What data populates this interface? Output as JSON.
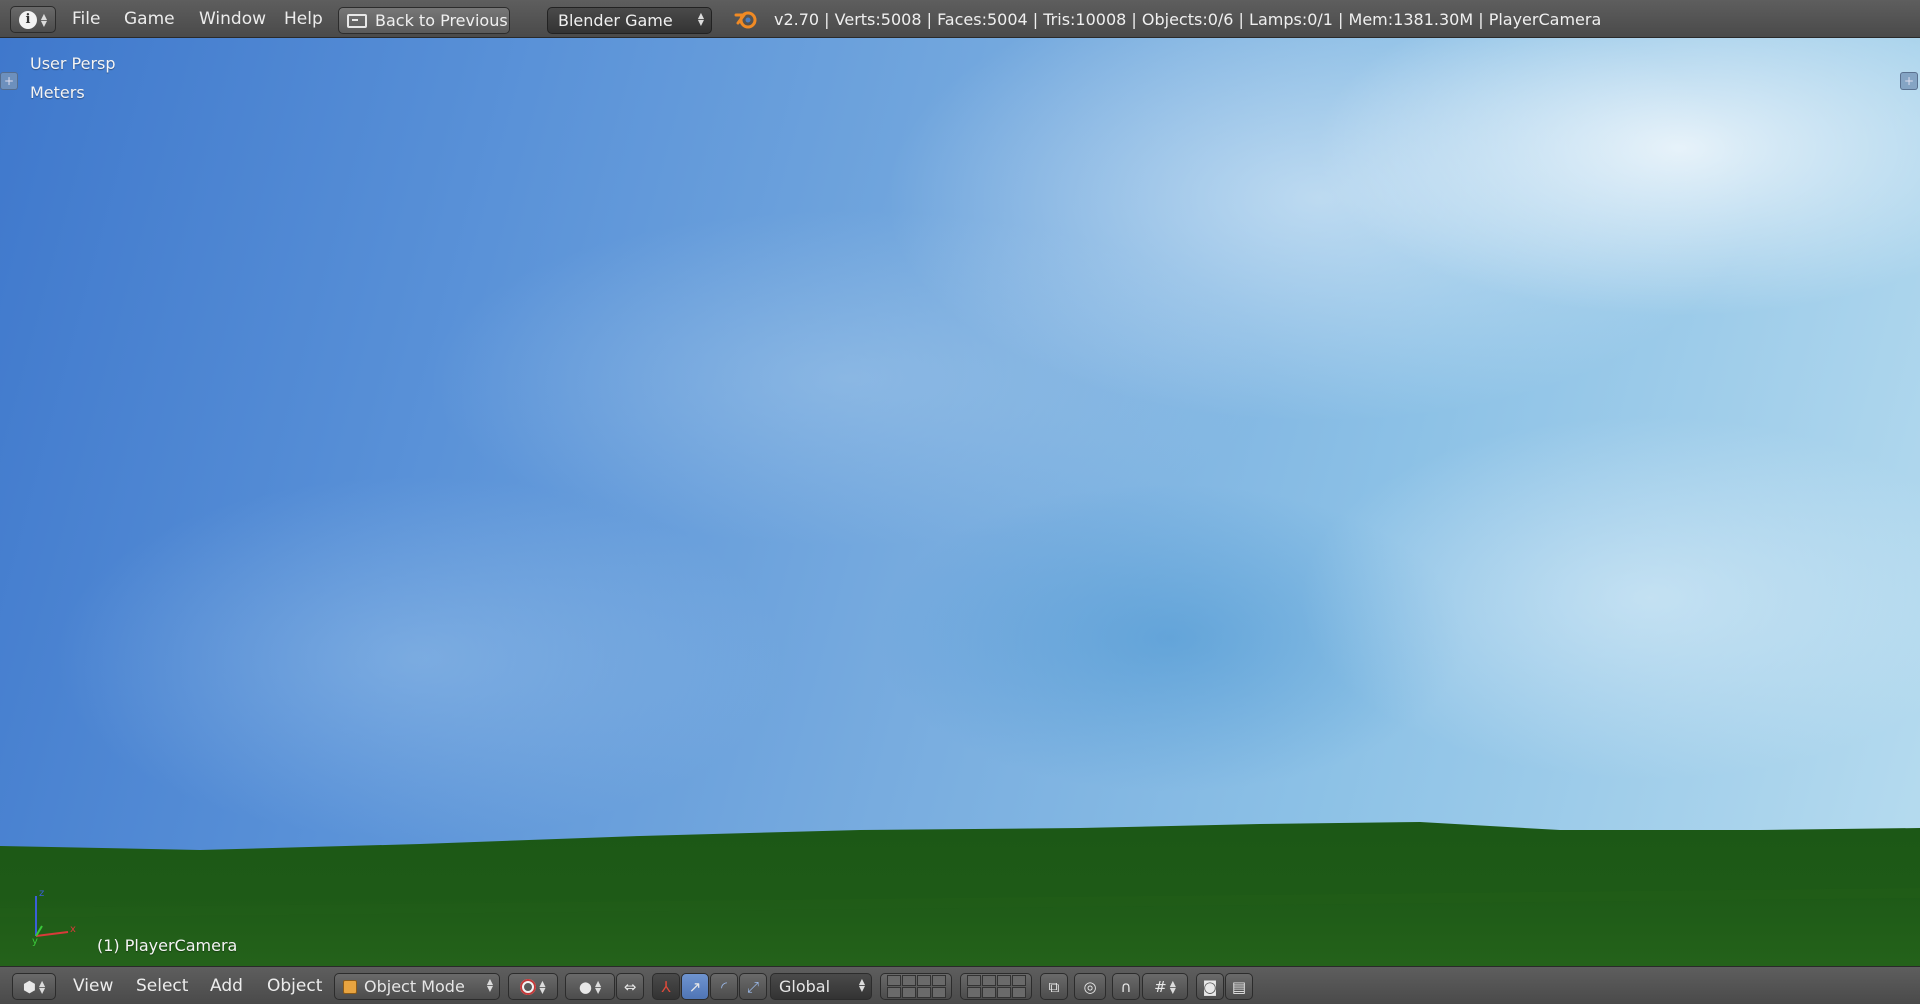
{
  "colors": {
    "header_bg": "#555555",
    "sky_dark": "#3f78cc",
    "sky_light": "#b7dcef",
    "ground": "#1f5a16",
    "accent_blue": "#5680c2"
  },
  "top_header": {
    "editor_icon": "info-icon",
    "menus": [
      "File",
      "Game",
      "Window",
      "Help"
    ],
    "back_button": "Back to Previous",
    "render_engine": "Blender Game",
    "logo_icon": "blender-logo-icon",
    "stats": "v2.70 | Verts:5008 | Faces:5004 | Tris:10008 | Objects:0/6 | Lamps:0/1 | Mem:1381.30M | PlayerCamera"
  },
  "viewport": {
    "view_name": "User Persp",
    "units": "Meters",
    "active_object": "(1) PlayerCamera",
    "axis_labels": {
      "x": "x",
      "y": "y",
      "z": "z"
    }
  },
  "bottom_header": {
    "editor_icon": "3d-view-icon",
    "menus": [
      "View",
      "Select",
      "Add",
      "Object"
    ],
    "mode": "Object Mode",
    "transform_orientation": "Global"
  }
}
